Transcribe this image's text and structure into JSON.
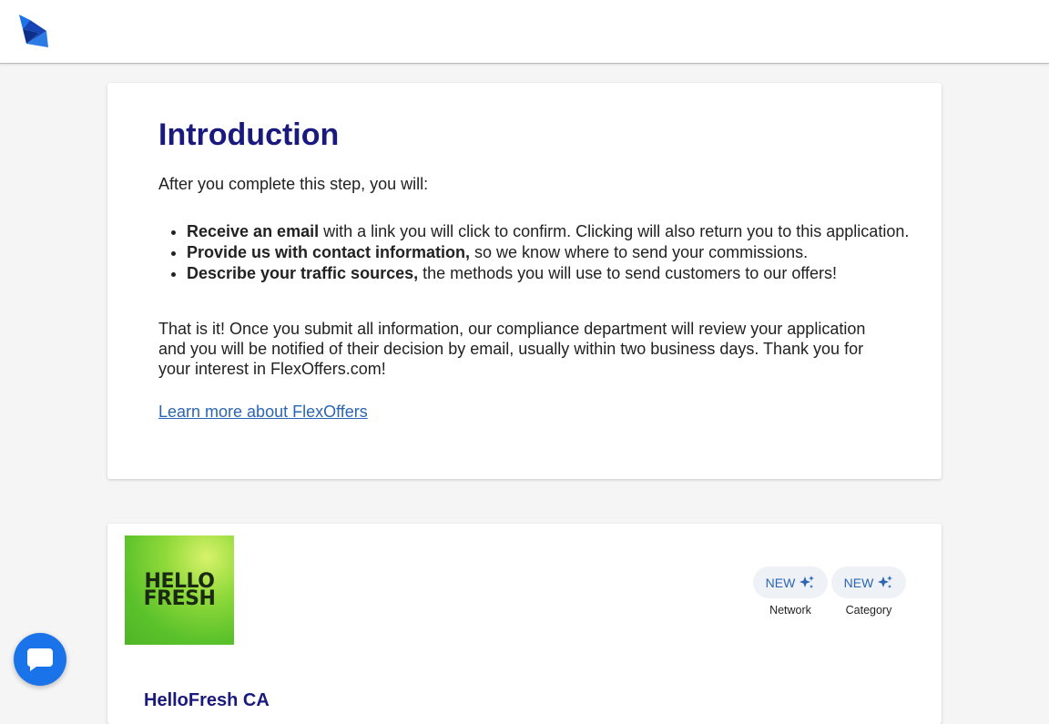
{
  "intro": {
    "title": "Introduction",
    "lead": "After you complete this step, you will:",
    "items": [
      {
        "bold": "Receive an email",
        "rest": " with a link you will click to confirm. Clicking will also return you to this application."
      },
      {
        "bold": "Provide us with contact information,",
        "rest": " so we know where to send your commissions."
      },
      {
        "bold": "Describe your traffic sources,",
        "rest": " the methods you will use to send customers to our offers!"
      }
    ],
    "body": "That is it! Once you submit all information, our compliance department will review your application and you will be notified of their decision by email, usually within two business days. Thank you for your interest in FlexOffers.com!",
    "link": "Learn more about FlexOffers"
  },
  "offer": {
    "logo_lines": [
      "HELLO",
      "FRESH"
    ],
    "title": "HelloFresh CA",
    "badges": [
      {
        "label": "NEW",
        "caption": "Network",
        "icon": "sparkle-icon"
      },
      {
        "label": "NEW",
        "caption": "Category",
        "icon": "sparkle-icon"
      }
    ]
  },
  "chat": {
    "icon": "chat-bubble-icon"
  },
  "colors": {
    "heading": "#1a1a7e",
    "link": "#2a66b3",
    "chat": "#1a73e8",
    "badge_bg": "#eef1f6"
  }
}
